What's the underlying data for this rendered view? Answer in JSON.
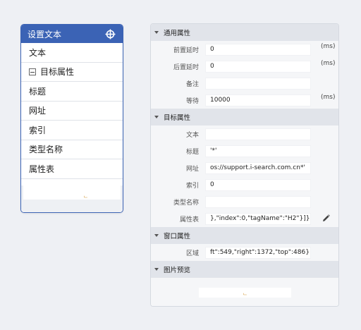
{
  "node": {
    "title": "设置文本",
    "items": [
      {
        "label": "文本"
      },
      {
        "label": "目标属性",
        "group": true
      },
      {
        "label": "标题"
      },
      {
        "label": "网址"
      },
      {
        "label": "索引"
      },
      {
        "label": "类型名称"
      },
      {
        "label": "属性表"
      }
    ]
  },
  "panel": {
    "general": {
      "title": "通用属性",
      "pre_delay": {
        "label": "前置延时",
        "value": "0",
        "unit": "(ms)"
      },
      "post_delay": {
        "label": "后置延时",
        "value": "0",
        "unit": "(ms)"
      },
      "note": {
        "label": "备注",
        "value": ""
      },
      "wait": {
        "label": "等待",
        "value": "10000",
        "unit": "(ms)"
      }
    },
    "target": {
      "title": "目标属性",
      "text": {
        "label": "文本",
        "value": ""
      },
      "title_field": {
        "label": "标题",
        "value": "'*'"
      },
      "url": {
        "label": "网址",
        "value": "os://support.i-search.com.cn*'"
      },
      "index": {
        "label": "索引",
        "value": "0"
      },
      "type_name": {
        "label": "类型名称",
        "value": ""
      },
      "attr_table": {
        "label": "属性表",
        "value": "},\"index\":0,\"tagName\":\"H2\"}]}"
      }
    },
    "window": {
      "title": "窗口属性",
      "region": {
        "label": "区域",
        "value": "ft\":549,\"right\":1372,\"top\":486}"
      }
    },
    "preview": {
      "title": "图片预览"
    }
  },
  "colors": {
    "accent": "#3b63b5",
    "section_bg": "#e1e4ea",
    "row_bg": "#f5f6f8"
  },
  "icons": {
    "header": "crosshair-icon",
    "edit": "pencil-icon",
    "collapse": "minus-box-icon",
    "caret": "caret-down-icon",
    "broken": "broken-image-icon"
  }
}
